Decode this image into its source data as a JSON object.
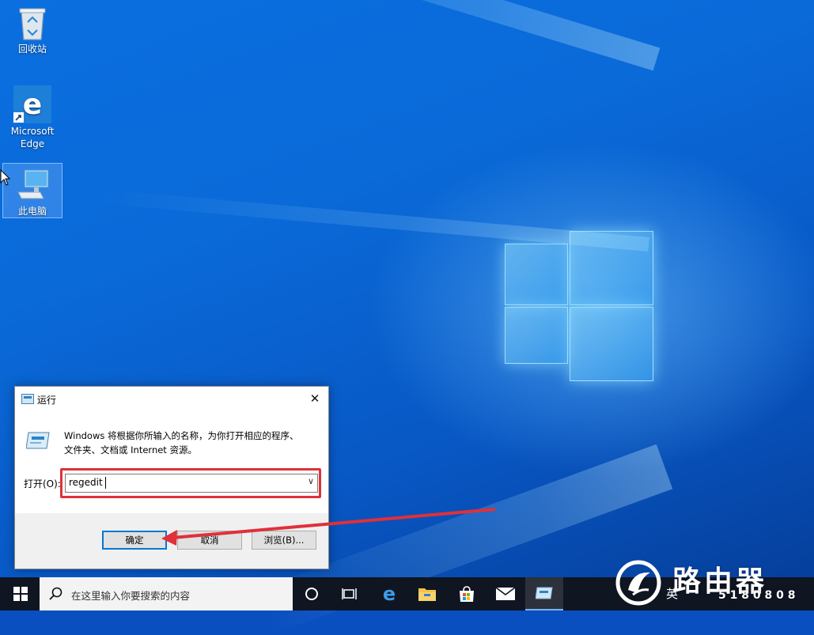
{
  "desktop": {
    "icons": [
      {
        "label": "回收站"
      },
      {
        "label_line1": "Microsoft",
        "label_line2": "Edge"
      },
      {
        "label": "此电脑"
      }
    ]
  },
  "run_dialog": {
    "title": "运行",
    "close_glyph": "✕",
    "description_line1": "Windows 将根据你所输入的名称，为你打开相应的程序、",
    "description_line2": "文件夹、文档或 Internet 资源。",
    "open_label": "打开(O):",
    "input_value": "regedit",
    "ok_label": "确定",
    "cancel_label": "取消",
    "browse_label": "浏览(B)..."
  },
  "taskbar": {
    "search_placeholder": "在这里输入你要搜索的内容",
    "tray_lang": "英",
    "icons": [
      "windows-start-icon",
      "search-icon",
      "cortana-icon",
      "task-view-icon",
      "edge-icon",
      "file-explorer-icon",
      "store-icon",
      "mail-icon",
      "run-icon"
    ]
  },
  "watermark": {
    "brand": "路由器",
    "subtitle": "5 1 8 0 8 0 8"
  },
  "colors": {
    "highlight": "#e0303a",
    "accent": "#0078d7",
    "taskbar": "#101522"
  }
}
